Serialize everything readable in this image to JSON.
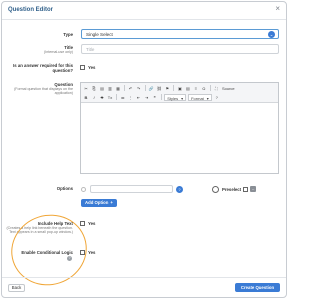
{
  "header": {
    "title": "Question Editor",
    "close": "×"
  },
  "fields": {
    "type": {
      "label": "Type",
      "value": "Single Select"
    },
    "title": {
      "label": "Title",
      "sublabel": "(Internal-use only)",
      "placeholder": "Title"
    },
    "required": {
      "label": "Is an answer required for this question?",
      "checkbox_label": "Yes"
    },
    "question": {
      "label": "Question",
      "sublabel": "(Formal question that displays on the application)"
    },
    "options": {
      "label": "Options"
    },
    "help_text": {
      "label": "Include Help Text",
      "sublabel": "(Creates a help link beneath the question. Text appears in a small pop-up window.)",
      "checkbox_label": "Yes"
    },
    "conditional": {
      "label": "Enable Conditional Logic",
      "checkbox_label": "Yes"
    }
  },
  "editor_toolbar": {
    "row1": [
      "✂",
      "⎘",
      "▤",
      "▥",
      "▦",
      "↶",
      "↷",
      "🔗",
      "⛓",
      "⚑",
      "▣",
      "▤",
      "≡",
      "Ω",
      "⊕",
      "⛶",
      "Source"
    ],
    "row2": [
      "B",
      "I",
      "S",
      "Tx",
      "≔",
      "⋮",
      "⇤",
      "⇥",
      "❝",
      "Styles",
      "Format",
      "?"
    ],
    "styles": "Styles",
    "format": "Format",
    "source": "Source"
  },
  "options_row": {
    "info": "?",
    "preselect": "Preselect",
    "add_button": "Add Option",
    "add_icon": "+"
  },
  "footer": {
    "back": "Back",
    "create": "Create Question"
  },
  "colors": {
    "accent": "#3a7bd5",
    "highlight": "#f0a637",
    "header_text": "#2f5f8a"
  }
}
